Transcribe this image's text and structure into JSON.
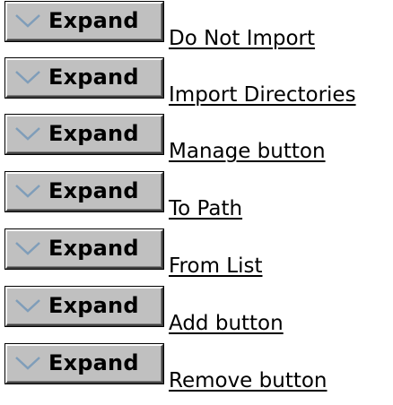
{
  "button_label": "Expand",
  "icons": {
    "expand": "chevron-down-icon"
  },
  "items": [
    {
      "label": "Do Not Import"
    },
    {
      "label": "Import Directories"
    },
    {
      "label": "Manage button"
    },
    {
      "label": "To Path"
    },
    {
      "label": "From List"
    },
    {
      "label": "Add button"
    },
    {
      "label": "Remove button"
    }
  ]
}
